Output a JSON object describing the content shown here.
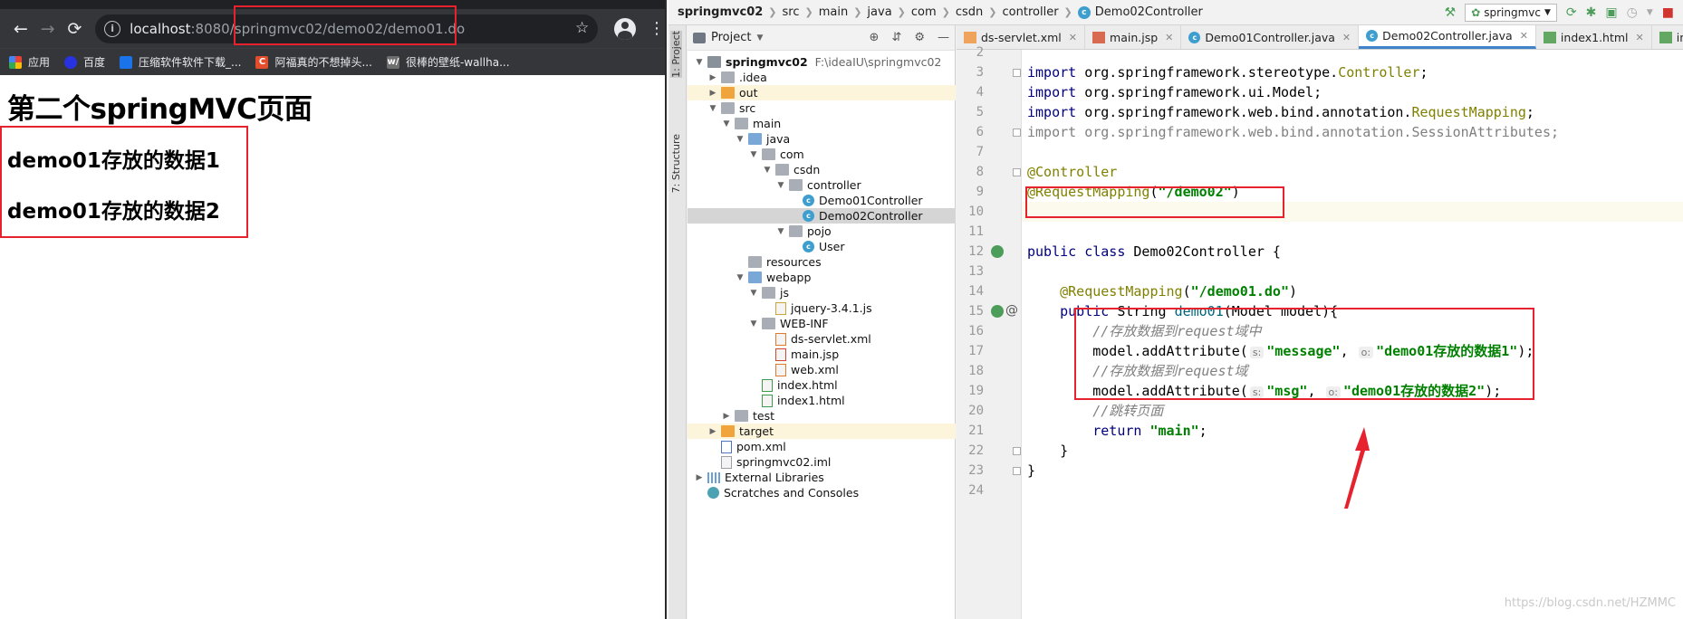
{
  "browser": {
    "url_host": "localhost",
    "url_path": ":8080/springmvc02/demo02/demo01.do",
    "bookmarks": [
      {
        "label": "应用",
        "icon": "apps-icon"
      },
      {
        "label": "百度",
        "icon": "baidu-icon"
      },
      {
        "label": "压缩软件软件下载_...",
        "icon": "download-site-icon"
      },
      {
        "label": "阿福真的不想掉头...",
        "icon": "csdn-icon",
        "glyph": "C"
      },
      {
        "label": "很棒的壁纸-wallha...",
        "icon": "wallhaven-icon",
        "glyph": "w/"
      }
    ],
    "page": {
      "title": "第二个springMVC页面",
      "data1": "demo01存放的数据1",
      "data2": "demo01存放的数据2"
    }
  },
  "ide": {
    "breadcrumbs": [
      "springmvc02",
      "src",
      "main",
      "java",
      "com",
      "csdn",
      "controller",
      "Demo02Controller"
    ],
    "run_config": "springmvc",
    "side_tabs": [
      "1: Project",
      "7: Structure"
    ],
    "project_header": "Project",
    "tree": [
      {
        "name": "springmvc02",
        "path": "F:\\ideaIU\\springmvc02",
        "depth": 0,
        "open": true,
        "icon": "root",
        "bold": true
      },
      {
        "name": ".idea",
        "depth": 1,
        "open": false,
        "icon": "folder"
      },
      {
        "name": "out",
        "depth": 1,
        "open": false,
        "icon": "folder-orange",
        "highlight": "excluded"
      },
      {
        "name": "src",
        "depth": 1,
        "open": true,
        "icon": "folder"
      },
      {
        "name": "main",
        "depth": 2,
        "open": true,
        "icon": "folder"
      },
      {
        "name": "java",
        "depth": 3,
        "open": true,
        "icon": "folder-blue"
      },
      {
        "name": "com",
        "depth": 4,
        "open": true,
        "icon": "folder"
      },
      {
        "name": "csdn",
        "depth": 5,
        "open": true,
        "icon": "folder"
      },
      {
        "name": "controller",
        "depth": 6,
        "open": true,
        "icon": "folder"
      },
      {
        "name": "Demo01Controller",
        "depth": 7,
        "icon": "class"
      },
      {
        "name": "Demo02Controller",
        "depth": 7,
        "icon": "class",
        "highlight": "selected"
      },
      {
        "name": "pojo",
        "depth": 6,
        "open": true,
        "icon": "folder"
      },
      {
        "name": "User",
        "depth": 7,
        "icon": "class"
      },
      {
        "name": "resources",
        "depth": 3,
        "icon": "folder"
      },
      {
        "name": "webapp",
        "depth": 3,
        "open": true,
        "icon": "folder-blue"
      },
      {
        "name": "js",
        "depth": 4,
        "open": true,
        "icon": "folder"
      },
      {
        "name": "jquery-3.4.1.js",
        "depth": 5,
        "icon": "file-js"
      },
      {
        "name": "WEB-INF",
        "depth": 4,
        "open": true,
        "icon": "folder"
      },
      {
        "name": "ds-servlet.xml",
        "depth": 5,
        "icon": "file-xml"
      },
      {
        "name": "main.jsp",
        "depth": 5,
        "icon": "file-jsp"
      },
      {
        "name": "web.xml",
        "depth": 5,
        "icon": "file-xml"
      },
      {
        "name": "index.html",
        "depth": 4,
        "icon": "file-html"
      },
      {
        "name": "index1.html",
        "depth": 4,
        "icon": "file-html"
      },
      {
        "name": "test",
        "depth": 2,
        "open": false,
        "icon": "folder"
      },
      {
        "name": "target",
        "depth": 1,
        "open": false,
        "icon": "folder-orange",
        "highlight": "excluded"
      },
      {
        "name": "pom.xml",
        "depth": 1,
        "icon": "file-m"
      },
      {
        "name": "springmvc02.iml",
        "depth": 1,
        "icon": "file"
      },
      {
        "name": "External Libraries",
        "depth": 0,
        "open": false,
        "icon": "library"
      },
      {
        "name": "Scratches and Consoles",
        "depth": 0,
        "icon": "scratch"
      }
    ],
    "tabs": [
      {
        "label": "ds-servlet.xml",
        "icon": "xml",
        "active": false
      },
      {
        "label": "main.jsp",
        "icon": "jsp",
        "active": false
      },
      {
        "label": "Demo01Controller.java",
        "icon": "java",
        "active": false
      },
      {
        "label": "Demo02Controller.java",
        "icon": "java",
        "active": true
      },
      {
        "label": "index1.html",
        "icon": "html",
        "active": false
      },
      {
        "label": "index.html",
        "icon": "html",
        "active": false
      }
    ],
    "code": [
      {
        "n": "2",
        "t": [
          [
            "",
            ""
          ]
        ]
      },
      {
        "n": "3",
        "t": [
          [
            "kw-plain",
            "import "
          ],
          [
            "",
            "org.springframework.stereotype."
          ],
          [
            "typ",
            "Controller"
          ],
          [
            "",
            ";"
          ]
        ]
      },
      {
        "n": "4",
        "t": [
          [
            "kw-plain",
            "import "
          ],
          [
            "",
            "org.springframework.ui.Model;"
          ]
        ]
      },
      {
        "n": "5",
        "t": [
          [
            "kw-plain",
            "import "
          ],
          [
            "",
            "org.springframework.web.bind.annotation."
          ],
          [
            "typ",
            "RequestMapping"
          ],
          [
            "",
            ";"
          ]
        ]
      },
      {
        "n": "6",
        "t": [
          [
            "gray",
            "import org.springframework.web.bind.annotation.SessionAttributes;"
          ]
        ]
      },
      {
        "n": "7",
        "t": []
      },
      {
        "n": "8",
        "t": [
          [
            "ann",
            "@Controller"
          ]
        ]
      },
      {
        "n": "9",
        "t": [
          [
            "ann",
            "@RequestMapping"
          ],
          [
            "",
            "("
          ],
          [
            "str",
            "\"/demo02\""
          ],
          [
            "",
            ")"
          ]
        ]
      },
      {
        "n": "10",
        "t": [],
        "current": true
      },
      {
        "n": "11",
        "t": []
      },
      {
        "n": "12",
        "t": [
          [
            "kw-plain",
            "public class "
          ],
          [
            "",
            "Demo02Controller {"
          ]
        ]
      },
      {
        "n": "13",
        "t": []
      },
      {
        "n": "14",
        "t": [
          [
            "",
            "    "
          ],
          [
            "ann",
            "@RequestMapping"
          ],
          [
            "",
            "("
          ],
          [
            "str",
            "\"/demo01.do\""
          ],
          [
            "",
            ")"
          ]
        ]
      },
      {
        "n": "15",
        "t": [
          [
            "",
            "    "
          ],
          [
            "kw-plain",
            "public "
          ],
          [
            "",
            "String "
          ],
          [
            "fn",
            "demo01"
          ],
          [
            "",
            "(Model model){"
          ]
        ]
      },
      {
        "n": "16",
        "t": [
          [
            "",
            "        "
          ],
          [
            "cmt",
            "//存放数据到request域中"
          ]
        ]
      },
      {
        "n": "17",
        "t": [
          [
            "",
            "        model.addAttribute("
          ],
          [
            "hint",
            "s:"
          ],
          [
            "str",
            "\"message\""
          ],
          [
            "",
            ", "
          ],
          [
            "hint",
            "o:"
          ],
          [
            "str",
            "\"demo01存放的数据1\""
          ],
          [
            "",
            ");"
          ]
        ]
      },
      {
        "n": "18",
        "t": [
          [
            "",
            "        "
          ],
          [
            "cmt",
            "//存放数据到request域"
          ]
        ]
      },
      {
        "n": "19",
        "t": [
          [
            "",
            "        model.addAttribute("
          ],
          [
            "hint",
            "s:"
          ],
          [
            "str",
            "\"msg\""
          ],
          [
            "",
            ", "
          ],
          [
            "hint",
            "o:"
          ],
          [
            "str",
            "\"demo01存放的数据2\""
          ],
          [
            "",
            ");"
          ]
        ]
      },
      {
        "n": "20",
        "t": [
          [
            "",
            "        "
          ],
          [
            "cmt",
            "//跳转页面"
          ]
        ]
      },
      {
        "n": "21",
        "t": [
          [
            "",
            "        "
          ],
          [
            "kw-plain",
            "return "
          ],
          [
            "str",
            "\"main\""
          ],
          [
            "",
            ";"
          ]
        ]
      },
      {
        "n": "22",
        "t": [
          [
            "",
            "    }"
          ]
        ]
      },
      {
        "n": "23",
        "t": [
          [
            "",
            "}"
          ]
        ]
      },
      {
        "n": "24",
        "t": []
      }
    ],
    "watermark": "https://blog.csdn.net/HZMMC"
  },
  "colors": {
    "annotation_red": "#e6222f",
    "selection": "#d5d5d5",
    "accent": "#4083c9"
  }
}
